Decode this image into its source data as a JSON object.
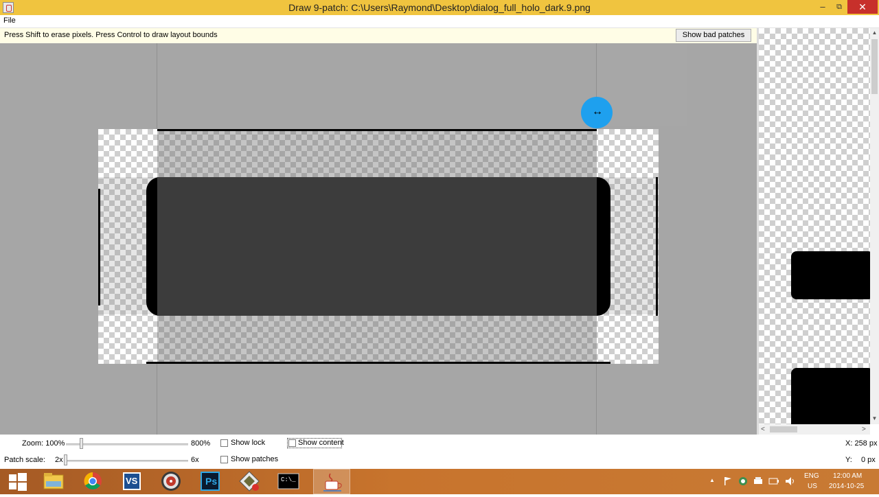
{
  "window": {
    "title": "Draw 9-patch: C:\\Users\\Raymond\\Desktop\\dialog_full_holo_dark.9.png",
    "minimize_glyph": "–",
    "maximize_glyph": "⧉",
    "close_glyph": "✕"
  },
  "menu": {
    "file": "File"
  },
  "hint": {
    "text": "Press Shift to erase pixels. Press Control to draw layout bounds",
    "bad_patches_button": "Show bad patches"
  },
  "editor": {
    "cursor_icon": "resize-horizontal-icon",
    "cursor_glyph": "↔"
  },
  "preview": {
    "scroll_up": "▲",
    "scroll_down": "▼",
    "scroll_left": "<",
    "scroll_right": ">"
  },
  "controls": {
    "zoom_label": "Zoom: 100%",
    "zoom_max": "800%",
    "patch_scale_label": "Patch scale:",
    "patch_scale_min": "2x",
    "patch_scale_max": "6x",
    "show_lock": "Show lock",
    "show_patches": "Show patches",
    "show_content": "Show content",
    "coord_x": "X: 258 px",
    "coord_y": "Y:",
    "coord_y_value": "0 px"
  },
  "taskbar": {
    "items": [
      "start-button",
      "file-explorer",
      "chrome",
      "visual-studio",
      "media-player",
      "photoshop",
      "app",
      "command-prompt",
      "java"
    ],
    "photoshop_label": "Ps",
    "vs_label": "VS",
    "cmd_label": "C:\\_",
    "tray": {
      "lang_top": "ENG",
      "lang_bottom": "US",
      "time": "12:00 AM",
      "date": "2014-10-25"
    }
  }
}
